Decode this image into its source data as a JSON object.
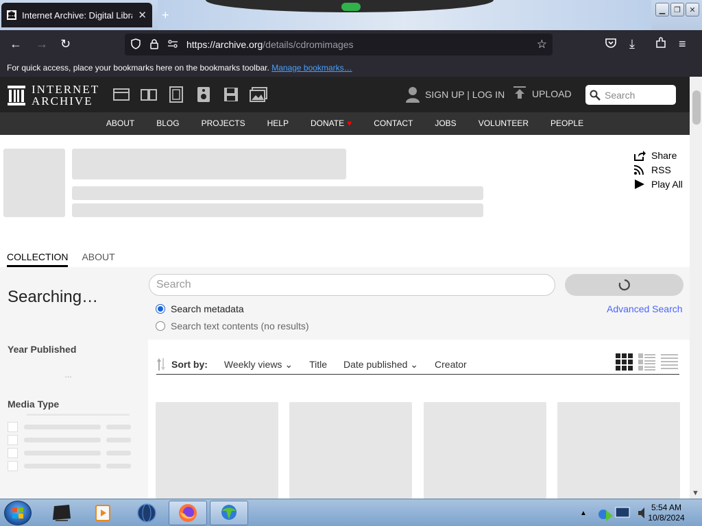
{
  "browser": {
    "tab_title": "Internet Archive: Digital Library",
    "url_host": "https://archive.org",
    "url_path": "/details/cdromimages",
    "bookmarks_text": "For quick access, place your bookmarks here on the bookmarks toolbar.",
    "bookmarks_link": "Manage bookmarks…"
  },
  "ia_header": {
    "logo_line1": "INTERNET",
    "logo_line2": "ARCHIVE",
    "signup": "SIGN UP | LOG IN",
    "upload": "UPLOAD",
    "search_placeholder": "Search",
    "nav": [
      "ABOUT",
      "BLOG",
      "PROJECTS",
      "HELP",
      "DONATE",
      "CONTACT",
      "JOBS",
      "VOLUNTEER",
      "PEOPLE"
    ]
  },
  "item_actions": {
    "share": "Share",
    "rss": "RSS",
    "play_all": "Play All"
  },
  "tabs": {
    "collection": "COLLECTION",
    "about": "ABOUT"
  },
  "sidebar": {
    "status": "Searching…",
    "year_published": "Year Published",
    "year_loading": "…",
    "media_type": "Media Type"
  },
  "search": {
    "placeholder": "Search",
    "opt_metadata": "Search metadata",
    "opt_text": "Search text contents (no results)",
    "advanced": "Advanced Search"
  },
  "sort": {
    "label": "Sort by:",
    "weekly_views": "Weekly views",
    "title": "Title",
    "date_published": "Date published",
    "creator": "Creator"
  },
  "taskbar": {
    "time": "5:54 AM",
    "date": "10/8/2024"
  },
  "colors": {
    "ia_dark": "#222222",
    "ia_nav": "#333333",
    "link_blue": "#4b64ff",
    "donate_heart": "#ff0100",
    "radio_blue": "#1b63d8"
  }
}
